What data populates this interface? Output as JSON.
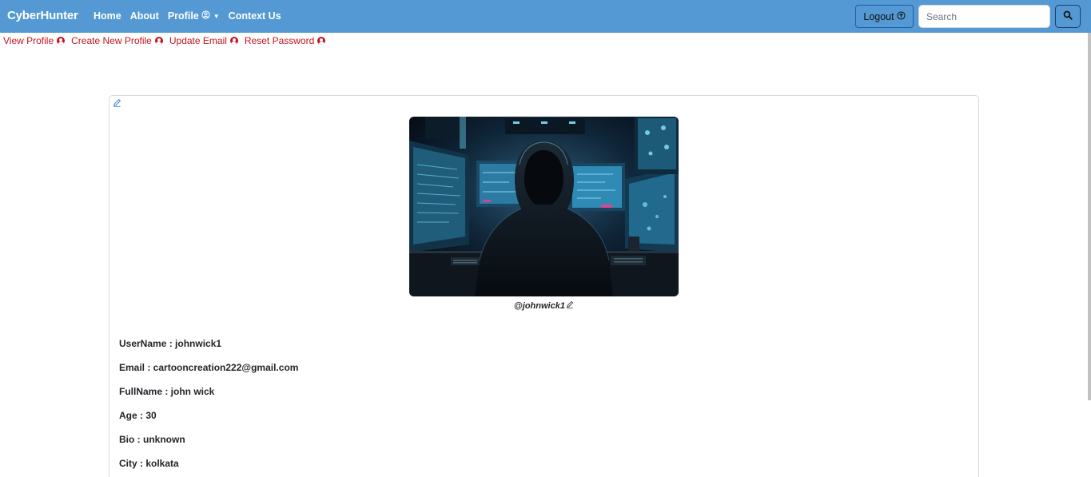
{
  "navbar": {
    "brand": "CyberHunter",
    "links": [
      "Home",
      "About",
      "Profile",
      "Context Us"
    ],
    "logout_label": "Logout",
    "search_placeholder": "Search"
  },
  "subnav": {
    "items": [
      "View Profile",
      "Create New Profile",
      "Update Email",
      "Reset Password"
    ]
  },
  "profile": {
    "handle": "@johnwick1",
    "fields": [
      {
        "label": "UserName",
        "value": "johnwick1"
      },
      {
        "label": "Email",
        "value": "cartooncreation222@gmail.com"
      },
      {
        "label": "FullName",
        "value": "john wick"
      },
      {
        "label": "Age",
        "value": "30"
      },
      {
        "label": "Bio",
        "value": "unknown"
      },
      {
        "label": "City",
        "value": "kolkata"
      }
    ],
    "lines": [
      "UserName : johnwick1",
      "Email : cartooncreation222@gmail.com",
      "FullName : john wick",
      "Age : 30",
      "Bio : unknown",
      "City : kolkata"
    ]
  },
  "colors": {
    "navbar": "#5499d4",
    "subnav_link": "#c0141e",
    "text": "#212529"
  },
  "icons": {
    "nav_profile": "user-circle-outline-icon",
    "profile_caret": "caret-down-icon",
    "logout": "arrow-up-circle-icon",
    "search": "magnifier-icon",
    "subnav": "user-circle-solid-icon",
    "edit": "pencil-icon"
  }
}
